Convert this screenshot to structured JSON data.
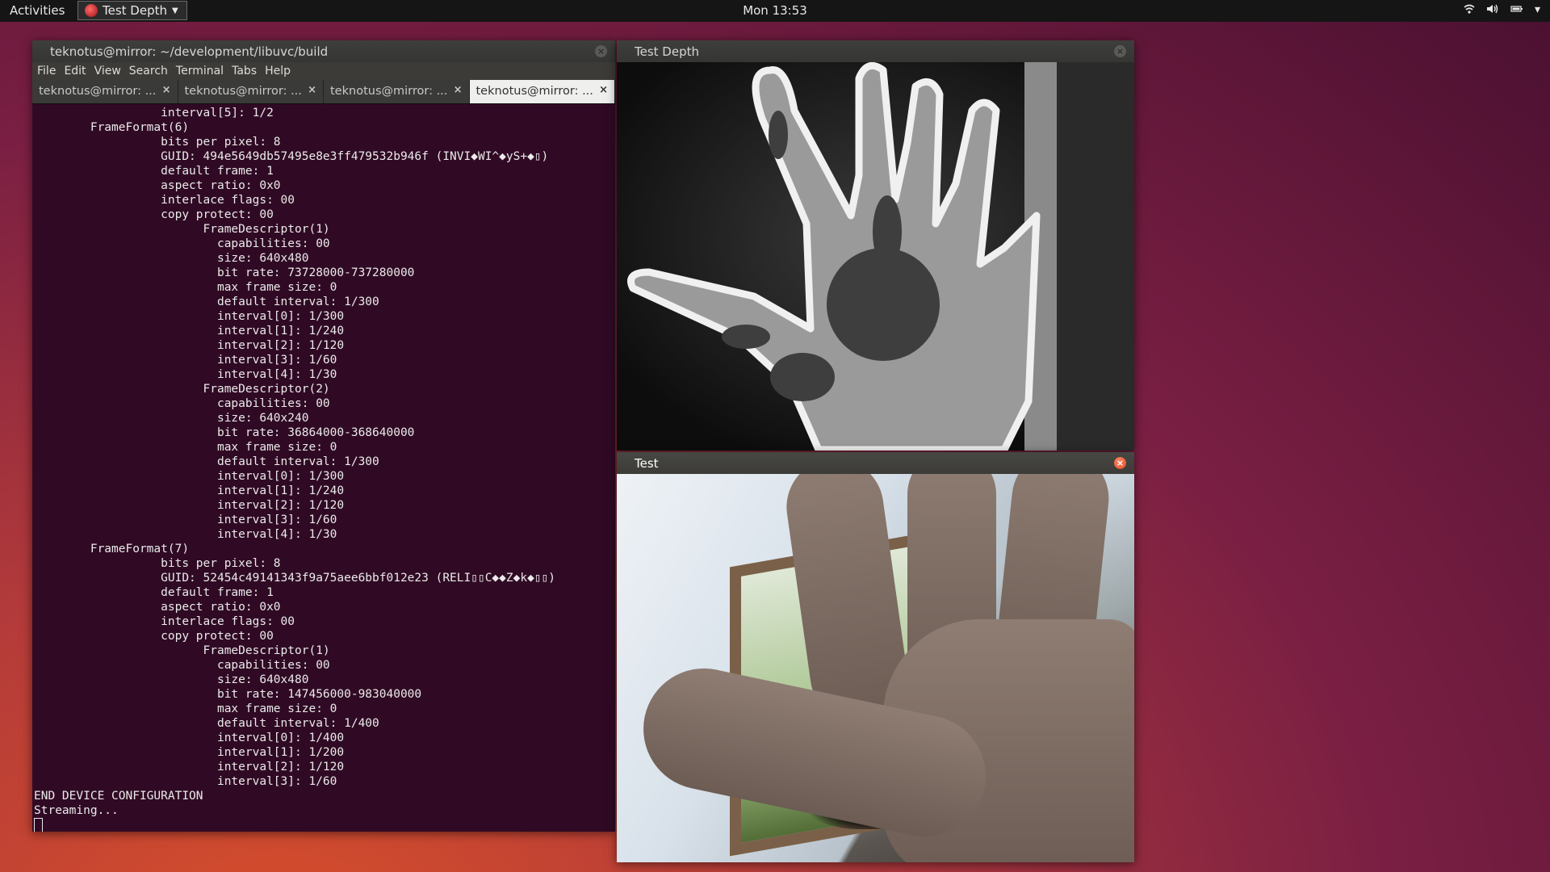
{
  "topbar": {
    "activities": "Activities",
    "app_menu": "Test Depth",
    "clock": "Mon 13:53",
    "tray_icons": [
      "wifi-icon",
      "volume-icon",
      "battery-icon",
      "menu-caret-icon"
    ]
  },
  "terminal": {
    "title": "teknotus@mirror: ~/development/libuvc/build",
    "menu": [
      "File",
      "Edit",
      "View",
      "Search",
      "Terminal",
      "Tabs",
      "Help"
    ],
    "tabs": [
      {
        "label": "teknotus@mirror: ..."
      },
      {
        "label": "teknotus@mirror: ..."
      },
      {
        "label": "teknotus@mirror: ..."
      },
      {
        "label": "teknotus@mirror: ..."
      }
    ],
    "active_tab": 3,
    "lines": [
      "                  interval[5]: 1/2",
      "        FrameFormat(6)",
      "                  bits per pixel: 8",
      "                  GUID: 494e5649db57495e8e3ff479532b946f (INVI◆WI^◆yS+◆▯)",
      "                  default frame: 1",
      "                  aspect ratio: 0x0",
      "                  interlace flags: 00",
      "                  copy protect: 00",
      "                        FrameDescriptor(1)",
      "                          capabilities: 00",
      "                          size: 640x480",
      "                          bit rate: 73728000-737280000",
      "                          max frame size: 0",
      "                          default interval: 1/300",
      "                          interval[0]: 1/300",
      "                          interval[1]: 1/240",
      "                          interval[2]: 1/120",
      "                          interval[3]: 1/60",
      "                          interval[4]: 1/30",
      "                        FrameDescriptor(2)",
      "                          capabilities: 00",
      "                          size: 640x240",
      "                          bit rate: 36864000-368640000",
      "                          max frame size: 0",
      "                          default interval: 1/300",
      "                          interval[0]: 1/300",
      "                          interval[1]: 1/240",
      "                          interval[2]: 1/120",
      "                          interval[3]: 1/60",
      "                          interval[4]: 1/30",
      "        FrameFormat(7)",
      "                  bits per pixel: 8",
      "                  GUID: 52454c49141343f9a75aee6bbf012e23 (RELI▯▯C◆◆Z◆k◆▯▯)",
      "                  default frame: 1",
      "                  aspect ratio: 0x0",
      "                  interlace flags: 00",
      "                  copy protect: 00",
      "                        FrameDescriptor(1)",
      "                          capabilities: 00",
      "                          size: 640x480",
      "                          bit rate: 147456000-983040000",
      "                          max frame size: 0",
      "                          default interval: 1/400",
      "                          interval[0]: 1/400",
      "                          interval[1]: 1/200",
      "                          interval[2]: 1/120",
      "                          interval[3]: 1/60",
      "END DEVICE CONFIGURATION",
      "Streaming..."
    ]
  },
  "depth_window": {
    "title": "Test Depth",
    "close": "×"
  },
  "test_window": {
    "title": "Test",
    "close": "×"
  }
}
